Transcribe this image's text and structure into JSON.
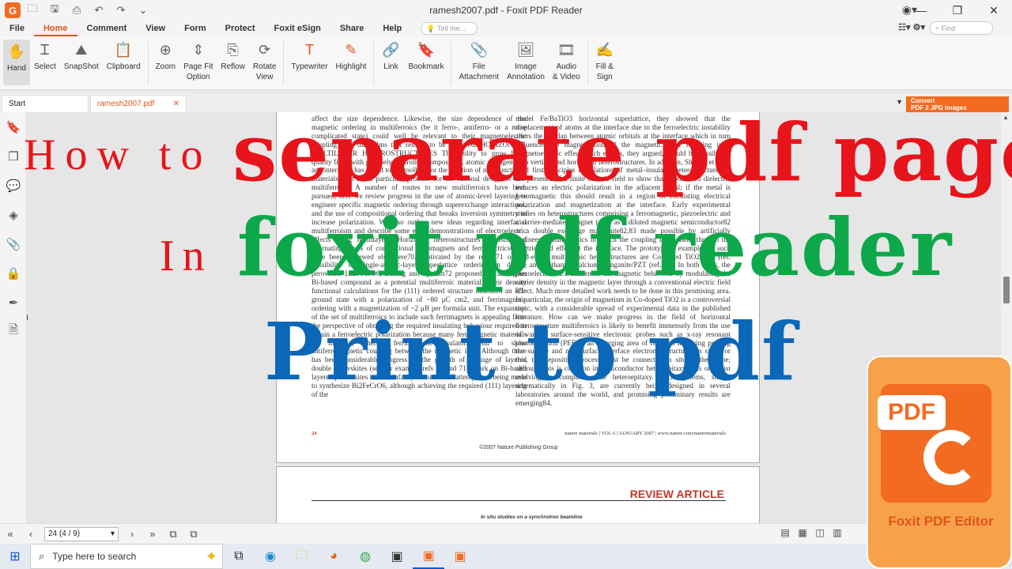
{
  "window": {
    "title": "ramesh2007.pdf - Foxit PDF Reader",
    "logo_letter": "G",
    "controls": [
      "—",
      "❐",
      "✕"
    ]
  },
  "menu": {
    "tabs": [
      "File",
      "Home",
      "Comment",
      "View",
      "Form",
      "Protect",
      "Foxit eSign",
      "Share",
      "Help"
    ],
    "tell_me_placeholder": "Tell me...",
    "find_placeholder": "Find"
  },
  "ribbon": {
    "hand": "Hand",
    "select": "Select",
    "snapshot": "SnapShot",
    "clipboard": "Clipboard",
    "zoom": "Zoom",
    "page_fit_1": "Page Fit",
    "page_fit_2": "Option",
    "reflow": "Reflow",
    "rotate_1": "Rotate",
    "rotate_2": "View",
    "typewriter": "Typewriter",
    "highlight": "Highlight",
    "link": "Link",
    "bookmark": "Bookmark",
    "file_att_1": "File",
    "file_att_2": "Attachment",
    "image_ann_1": "Image",
    "image_ann_2": "Annotation",
    "audio_1": "Audio",
    "audio_2": "& Video",
    "fill_1": "Fill &",
    "fill_2": "Sign"
  },
  "doc_tabs": {
    "start": "Start",
    "file": "ramesh2007.pdf",
    "convert_1": "Convert",
    "convert_2": "PDF 2 JPG images"
  },
  "document": {
    "left_col": "affect the size dependence. Likewise, the size dependence of the magnetic ordering in multiferroics (be it ferro-, antiferro- or a more complicated state) could well be relevant to their magnetoelectric coupling with thin films that remain to be explored. HORIZONTAL MULTILAYER HETEROSTRUCTURES The ability to grow high-quality films with precisely controlled composition, atomic arrangements and interfaces has added to the toolbox for the creation of new functional materials, and holds particular promise for the rational design of new multiferroics. A number of routes to new multiferroics have been pursued; here we review progress in the use of atomic-level layering to engineer specific magnetic ordering through superexchange interactions, and the use of compositional ordering that breaks inversion symmetry to increase polarization. We also outline new ideas regarding interfacial multiferroism and describe some early demonstrations of electroelectric effects using multilayers. Horizontal heterostructures consisting of alternating layers of conventional ferromagnets and ferroelectrics69,80 have been reviewed elsewhere70. Motivated by the report71 of the possibility of single-atomic-layer superlattice ordering in double perovskite La2FeCrO6, Baettig and Spaldin72 proposed the analogous Bi-based compound as a potential multiferroic material. Their density functional calculations for the (111) ordered structure indicated an R3c ground state with a polarization of ~80 μC cm2, and ferrimagnetic ordering with a magnetization of ~2 μB per formula unit. The expansion of the set of multiferroics to include such ferrimagnets is appealing from the perspective of obtaining the required insulating behaviour required to obtain a ferroelectric polarization because many ferromagnetic materials are metallic, whereas ferrimagnetic insulators tend to show antiferromagnetic coupling between the magnetic ions. Although there has been considerable progress on the growth of a range of layered double perovskites (see for example refs 73 and 71), work on Bi-based layered perovskites is in its infancy. A number of attempts are being made to synthesize Bi2FeCrO6, although achieving the required (111) layering of the",
    "right_col": "model Fe/BaTiO3 horizontal superlattice, they showed that the displacement of atoms at the interface due to the ferroelectric instability alters the overlap between atomic orbitals at the interface which in turn influences the magnetization of the magnetic layer resulting in a magnetoelectric effect. Such effects, they argued, should be possible in both vertical and horizontal heterostructures. In addition, Sharma et al.90 used first-principles calculations of metal–insulator heterostructures in the presence of a finite electric field to show that a polarized dielectric induces an electric polarization in the adjacent metal; if the metal is ferromagnetic this should result in a region of coexisting electrical polarization and magnetization at the interface. Early experimental studies on heterostructures comprising a ferromagnetic, piezoelectric and a carrier-mediated magnet (such as a diluted magnetic semiconductor82 or a double exchange manganite82,83 made possible by artificially engineered multiferroics in which the coupling is mediated through the electric field effect at the interface. The prototypical examples of such field-effect multiferroic heterostructures are Co-doped TiO2/PZT (ref. 82), and lanthanum calcium manganite/PZT (ref. 83). In both cases, the piezoelectric PZT influences the magnetic behaviour by modulating the carrier density in the magnetic layer through a conventional electric field effect. Much more detailed work needs to be done in this promising area. In particular, the origin of magnetism in Co-doped TiO2 is a controversial topic, with a considerable spread of experimental data in the published literature. How can we make progress in the field of horizontal heterostructure multiferroics is likely to benefit immensely from the use of various surface-sensitive electronic probes such as x-ray resonant photoemission (PEES), an emerging area of research involving probing the surface and near-surface interface electronic structures in situ. For this, the deposition process must be connected in situ to the probe; although this is common in semiconductor heteroepitaxy, it is only just evolving in complex oxide heteroepitaxy. Such systems, shown schematically in Fig. 3, are currently being designed in several laboratories around the world, and promising preliminary results are emerging84.",
    "page_number": "24",
    "footer_right": "nature materials | VOL 6 | JANUARY 2007 | www.nature.com/naturematerials",
    "publisher": "©2007 Nature Publishing Group",
    "next_page_heading": "REVIEW ARTICLE",
    "next_page_caption": "In situ studies on a synchrotron beamline"
  },
  "overlay": {
    "how_to": "How to",
    "separate": "separate pdf pages",
    "in": "In",
    "foxit": "foxit pdf reader",
    "print": "Print to pdf"
  },
  "navbar": {
    "page_value": "24 (4 / 9)"
  },
  "taskbar": {
    "search_placeholder": "Type here to search"
  },
  "promo": {
    "pdf": "PDF",
    "label": "Foxit PDF Editor"
  },
  "colors": {
    "accent": "#e0531a",
    "red_title": "#e8141b",
    "green_title": "#0ca84a",
    "blue_title": "#0b67b7"
  }
}
